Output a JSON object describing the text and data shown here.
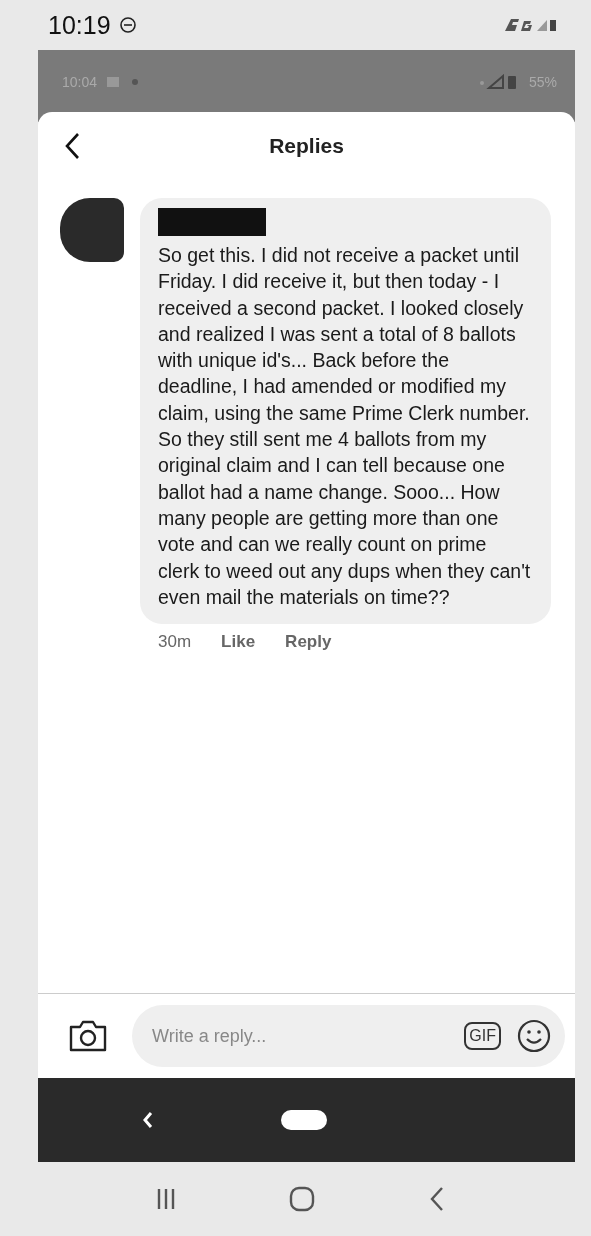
{
  "status_bar": {
    "time": "10:19"
  },
  "inner_status_bar": {
    "time": "10:04",
    "battery": "55%"
  },
  "header": {
    "title": "Replies"
  },
  "comment": {
    "text": "So get this. I did not receive a packet until Friday. I did receive it, but then today - I received a second packet. I looked closely and realized I was sent a total of 8 ballots with unique id's... Back before the deadline, I had amended or modified my claim, using the same Prime Clerk number. So they still sent me 4 ballots from my original claim and I can tell because one ballot had a name change. Sooo... How many people are getting more than one vote and can we really count on prime clerk to weed out any dups when they can't even mail the materials on time??",
    "time": "30m",
    "actions": [
      "Like",
      "Reply"
    ]
  },
  "reply_bar": {
    "placeholder": "Write a reply...",
    "gif": "GIF"
  }
}
